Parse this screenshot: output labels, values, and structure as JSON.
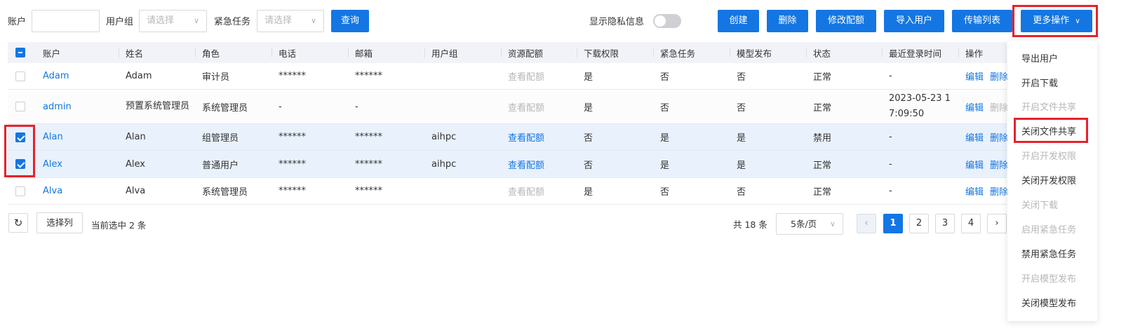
{
  "filters": {
    "account_label": "账户",
    "account_value": "",
    "group_label": "用户组",
    "group_placeholder": "请选择",
    "urgent_label": "紧急任务",
    "urgent_placeholder": "请选择",
    "query_label": "查询"
  },
  "privacy": {
    "label": "显示隐私信息",
    "on": false
  },
  "actions": {
    "create": "创建",
    "delete": "删除",
    "quota": "修改配额",
    "import": "导入用户",
    "transfer": "传输列表",
    "more": "更多操作"
  },
  "table": {
    "columns": [
      "账户",
      "姓名",
      "角色",
      "电话",
      "邮箱",
      "用户组",
      "资源配额",
      "下载权限",
      "紧急任务",
      "模型发布",
      "状态",
      "最近登录时间",
      "操作"
    ],
    "rows": [
      {
        "account": "Adam",
        "name": "Adam",
        "role": "审计员",
        "phone": "******",
        "email": "******",
        "group": "",
        "quota": "查看配额",
        "download": "是",
        "urgent": "否",
        "publish": "否",
        "status": "正常",
        "last_login": "-",
        "edit": "编辑",
        "del": "删除"
      },
      {
        "account": "admin",
        "name": "预置系统管理员",
        "role": "系统管理员",
        "phone": "-",
        "email": "-",
        "group": "",
        "quota": "查看配额",
        "download": "是",
        "urgent": "否",
        "publish": "否",
        "status": "正常",
        "last_login": "2023-05-23 17:09:50",
        "edit": "编辑",
        "del": "删除"
      },
      {
        "account": "Alan",
        "name": "Alan",
        "role": "组管理员",
        "phone": "******",
        "email": "******",
        "group": "aihpc",
        "quota": "查看配额",
        "download": "否",
        "urgent": "是",
        "publish": "是",
        "status": "禁用",
        "last_login": "-",
        "edit": "编辑",
        "del": "删除"
      },
      {
        "account": "Alex",
        "name": "Alex",
        "role": "普通用户",
        "phone": "******",
        "email": "******",
        "group": "aihpc",
        "quota": "查看配额",
        "download": "否",
        "urgent": "是",
        "publish": "是",
        "status": "正常",
        "last_login": "-",
        "edit": "编辑",
        "del": "删除"
      },
      {
        "account": "Alva",
        "name": "Alva",
        "role": "系统管理员",
        "phone": "******",
        "email": "******",
        "group": "",
        "quota": "查看配额",
        "download": "是",
        "urgent": "否",
        "publish": "否",
        "status": "正常",
        "last_login": "-",
        "edit": "编辑",
        "del": "删除"
      }
    ]
  },
  "footer": {
    "refresh_icon": "refresh-icon",
    "columns_button": "选择列",
    "selected_text": "当前选中 2 条",
    "total": "共 18 条",
    "page_size": "5条/页",
    "pages": [
      "1",
      "2",
      "3",
      "4"
    ],
    "prev_icon": "chevron-left-icon",
    "next_icon": "chevron-right-icon"
  },
  "more_menu": {
    "items": [
      {
        "label": "导出用户",
        "disabled": false
      },
      {
        "label": "开启下载",
        "disabled": false
      },
      {
        "label": "开启文件共享",
        "disabled": true
      },
      {
        "label": "关闭文件共享",
        "disabled": false
      },
      {
        "label": "开启开发权限",
        "disabled": true
      },
      {
        "label": "关闭开发权限",
        "disabled": false
      },
      {
        "label": "关闭下载",
        "disabled": true
      },
      {
        "label": "启用紧急任务",
        "disabled": true
      },
      {
        "label": "禁用紧急任务",
        "disabled": false
      },
      {
        "label": "开启模型发布",
        "disabled": true
      },
      {
        "label": "关闭模型发布",
        "disabled": false
      }
    ]
  },
  "colors": {
    "primary": "#1476e3",
    "highlight": "#e8212b",
    "header_bg": "#f1f3f8",
    "selected_row_bg": "#e9f1fd",
    "disabled_text": "#b7b7b7"
  }
}
